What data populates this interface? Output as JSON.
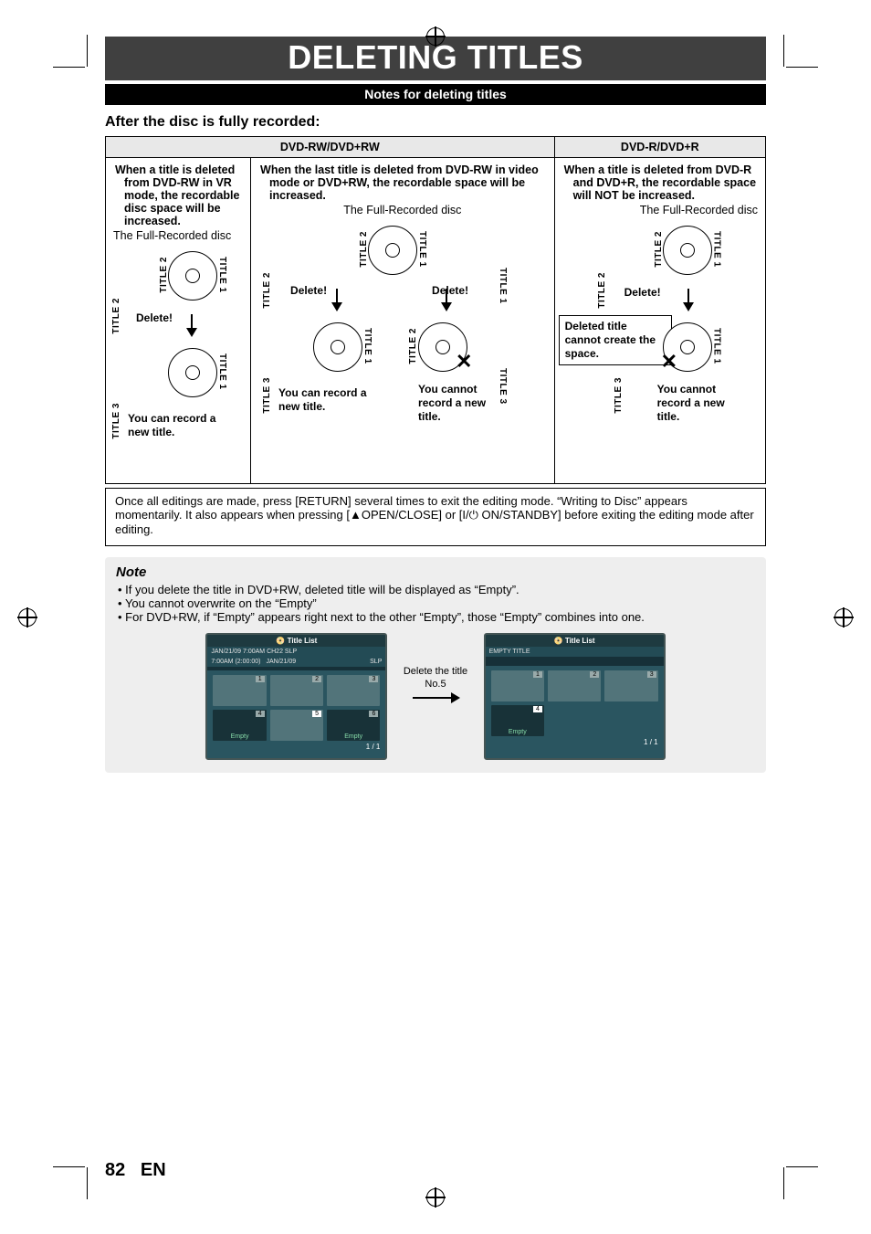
{
  "page": {
    "number": "82",
    "lang": "EN"
  },
  "header": {
    "title": "DELETING TITLES",
    "subbar": "Notes for deleting titles"
  },
  "section_heading": "After the disc is fully recorded:",
  "table": {
    "col1_header": "DVD-RW/DVD+RW",
    "col2_header": "DVD-R/DVD+R",
    "rw_vr": {
      "bullet": "When a title is deleted from DVD-RW in VR mode, the recordable disc space will be increased.",
      "sub": "The Full-Recorded disc",
      "delete": "Delete!",
      "result": "You can record a new title."
    },
    "rw_video": {
      "bullet": "When the last title is deleted from DVD-RW in video mode or DVD+RW, the recordable space will be increased.",
      "sub": "The Full-Recorded disc",
      "delete_l": "Delete!",
      "delete_r": "Delete!",
      "result_l": "You can record a new title.",
      "result_r": "You cannot record a new title."
    },
    "r": {
      "bullet": "When a title is deleted from DVD-R and DVD+R, the recordable space will NOT be increased.",
      "sub": "The Full-Recorded disc",
      "delete": "Delete!",
      "banner": "Deleted title cannot create the space.",
      "result": "You cannot record a new title."
    },
    "labels": {
      "t1": "TITLE 1",
      "t2": "TITLE 2",
      "t3": "TITLE 3"
    }
  },
  "exit_para": "Once all editings are made, press [RETURN] several times to exit the editing mode. “Writing to Disc” appears momentarily.  It also appears when pressing [▲OPEN/CLOSE] or [I/⏻ ON/STANDBY] before exiting the editing mode after editing.",
  "note": {
    "title": "Note",
    "b1": "If you delete the title in DVD+RW, deleted title will be displayed as “Empty”.",
    "b2": "You cannot overwrite on the “Empty”",
    "b3": "For DVD+RW, if “Empty” appears right next to the other “Empty”, those “Empty” combines into one."
  },
  "titlelist_left": {
    "header": "Title List",
    "line1": "JAN/21/09  7:00AM  CH22  SLP",
    "line2a": "7:00AM (2:00:00)",
    "line2b": "JAN/21/09",
    "line2c": "SLP",
    "thumbs": [
      {
        "n": "1",
        "lab": ""
      },
      {
        "n": "2",
        "lab": ""
      },
      {
        "n": "3",
        "lab": ""
      },
      {
        "n": "4",
        "lab": "Empty"
      },
      {
        "n": "5",
        "lab": "",
        "active": true
      },
      {
        "n": "6",
        "lab": "Empty"
      }
    ],
    "footer": "1 / 1"
  },
  "between": "Delete the title No.5",
  "titlelist_right": {
    "header": "Title List",
    "line1": "EMPTY TITLE",
    "thumbs": [
      {
        "n": "1",
        "lab": ""
      },
      {
        "n": "2",
        "lab": ""
      },
      {
        "n": "3",
        "lab": ""
      },
      {
        "n": "4",
        "lab": "Empty",
        "active": true
      },
      {
        "n": "",
        "lab": ""
      },
      {
        "n": "",
        "lab": ""
      }
    ],
    "footer": "1 / 1"
  }
}
